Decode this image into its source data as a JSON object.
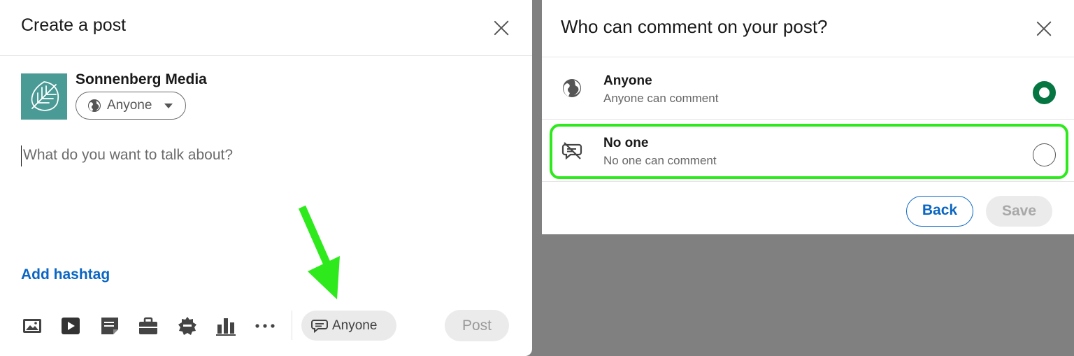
{
  "create_post": {
    "title": "Create a post",
    "author_name": "Sonnenberg Media",
    "audience_label": "Anyone",
    "input_placeholder": "What do you want to talk about?",
    "add_hashtag_label": "Add hashtag",
    "comment_control_label": "Anyone",
    "post_button_label": "Post",
    "toolbar_icons": [
      "photo-icon",
      "video-icon",
      "document-icon",
      "job-icon",
      "celebrate-icon",
      "poll-icon",
      "more-icon"
    ]
  },
  "comment_dialog": {
    "title": "Who can comment on your post?",
    "options": [
      {
        "title": "Anyone",
        "subtitle": "Anyone can comment",
        "icon": "globe-icon",
        "selected": true
      },
      {
        "title": "No one",
        "subtitle": "No one can comment",
        "icon": "no-comment-icon",
        "selected": false
      }
    ],
    "back_label": "Back",
    "save_label": "Save"
  },
  "colors": {
    "brand_blue": "#0a66c2",
    "selected_green": "#057642",
    "highlight_green": "#2eea1c",
    "overlay_gray": "#808080"
  }
}
